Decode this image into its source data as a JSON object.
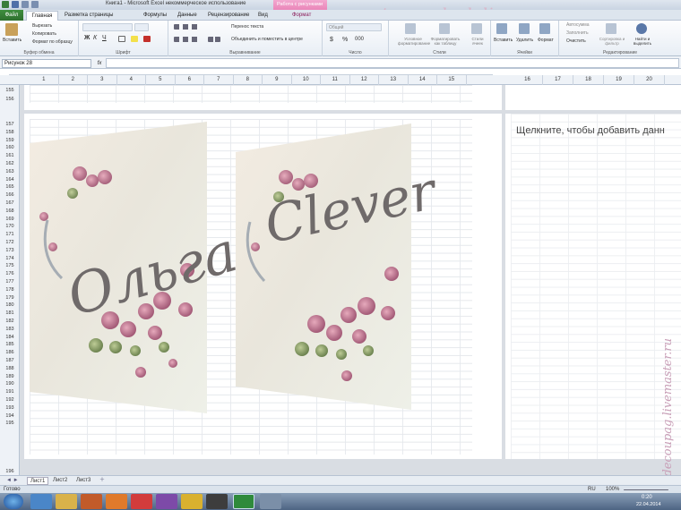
{
  "title": {
    "window_title": "Книга1 - Microsoft Excel некоммерческое использование",
    "context_tab": "Работа с рисунками"
  },
  "tabs": [
    "Файл",
    "Главная",
    "Разметка страницы",
    "Формулы",
    "Данные",
    "Рецензирование",
    "Вид",
    "Формат"
  ],
  "ribbon": {
    "clipboard": {
      "paste": "Вставить",
      "cut": "Вырезать",
      "copy": "Копировать",
      "format_painter": "Формат по образцу",
      "label": "Буфер обмена"
    },
    "font": {
      "label": "Шрифт"
    },
    "alignment": {
      "wrap": "Перенос текста",
      "merge": "Объединить и поместить в центре",
      "label": "Выравнивание"
    },
    "number": {
      "format": "Общий",
      "label": "Число"
    },
    "styles": {
      "conditional": "Условное форматирование",
      "as_table": "Форматировать как таблицу",
      "cell_styles": "Стили ячеек",
      "label": "Стили"
    },
    "cells": {
      "insert": "Вставить",
      "delete": "Удалить",
      "format": "Формат",
      "label": "Ячейки"
    },
    "editing": {
      "autosum": "Автосумма",
      "fill": "Заполнить",
      "clear": "Очистить",
      "sort": "Сортировка и фильтр",
      "find": "Найти и выделить",
      "label": "Редактирование"
    }
  },
  "formula_bar": {
    "name_box": "Рисунок 28",
    "fx": "fx",
    "value": ""
  },
  "columns_left": [
    "1",
    "2",
    "3",
    "4",
    "5",
    "6",
    "7",
    "8",
    "9",
    "10",
    "11",
    "12",
    "13",
    "14",
    "15"
  ],
  "columns_right": [
    "16",
    "17",
    "18",
    "19",
    "20"
  ],
  "rows_top": [
    "155",
    "156"
  ],
  "rows_main": [
    "157",
    "158",
    "159",
    "160",
    "161",
    "162",
    "163",
    "164",
    "165",
    "166",
    "167",
    "168",
    "169",
    "170",
    "171",
    "172",
    "173",
    "174",
    "175",
    "176",
    "177",
    "178",
    "179",
    "180",
    "181",
    "182",
    "183",
    "184",
    "185",
    "186",
    "187",
    "188",
    "189",
    "190",
    "191",
    "192",
    "193",
    "194",
    "195"
  ],
  "row_bottom": "196",
  "page_hint": "Щелкните, чтобы добавить данн",
  "artwork": {
    "text1": "Ольга",
    "text2": "Clever"
  },
  "sheets": [
    "Лист1",
    "Лист2",
    "Лист3"
  ],
  "status": {
    "ready": "Готово",
    "zoom": "100%",
    "lang": "RU"
  },
  "taskbar": {
    "time": "0:20",
    "date": "22.04.2014"
  },
  "watermarks": {
    "top": "mastera-rukodeliya.ru",
    "side": "olga-decoupag.livemaster.ru"
  },
  "colors": {
    "accent": "#2e6f2e",
    "context": "#e46aa8",
    "ribbon": "#e8eef5"
  }
}
